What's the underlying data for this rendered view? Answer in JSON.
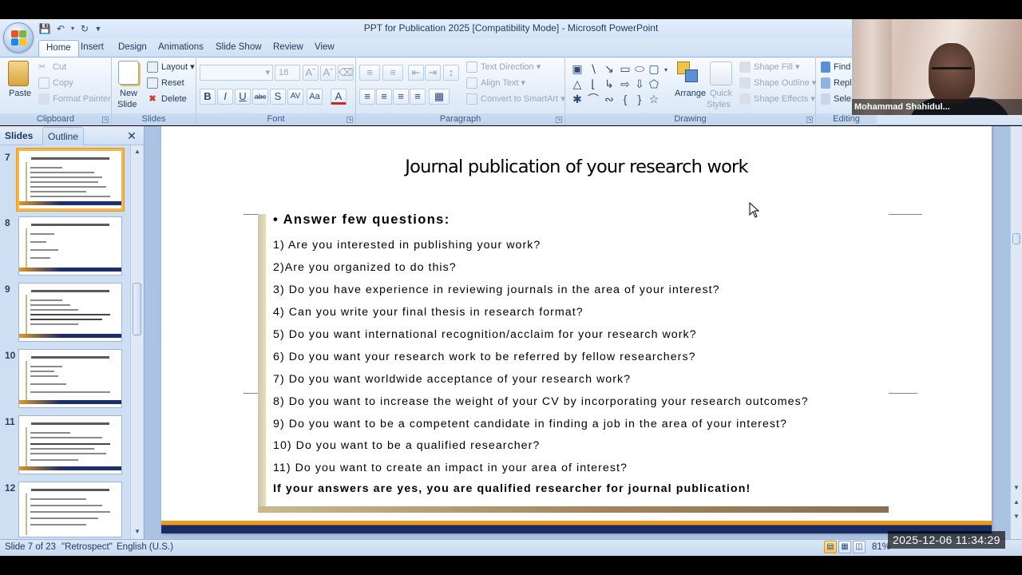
{
  "window": {
    "title": "PPT for Publication 2025 [Compatibility Mode] - Microsoft PowerPoint"
  },
  "ribbon_tabs": [
    "Home",
    "Insert",
    "Design",
    "Animations",
    "Slide Show",
    "Review",
    "View"
  ],
  "active_tab": "Home",
  "ribbon": {
    "clipboard": {
      "label": "Clipboard",
      "paste": "Paste",
      "cut": "Cut",
      "copy": "Copy",
      "format_painter": "Format Painter"
    },
    "slides": {
      "label": "Slides",
      "new_slide_1": "New",
      "new_slide_2": "Slide",
      "layout": "Layout",
      "reset": "Reset",
      "delete": "Delete"
    },
    "font": {
      "label": "Font",
      "font_size": "18",
      "buttons": [
        "B",
        "I",
        "U",
        "abc",
        "S",
        "AV",
        "Aa",
        "A"
      ]
    },
    "paragraph": {
      "label": "Paragraph",
      "text_direction": "Text Direction",
      "align_text": "Align Text",
      "convert_smartart": "Convert to SmartArt"
    },
    "drawing": {
      "label": "Drawing",
      "arrange": "Arrange",
      "quick_styles_1": "Quick",
      "quick_styles_2": "Styles",
      "shape_fill": "Shape Fill",
      "shape_outline": "Shape Outline",
      "shape_effects": "Shape Effects"
    },
    "editing": {
      "label": "Editing",
      "find": "Find",
      "replace": "Repl",
      "select": "Sele"
    }
  },
  "webcam": {
    "name": "Mohammad Shahidul..."
  },
  "left_pane": {
    "tabs": [
      "Slides",
      "Outline"
    ],
    "thumbnails": [
      {
        "number": "7",
        "selected": true
      },
      {
        "number": "8",
        "selected": false
      },
      {
        "number": "9",
        "selected": false
      },
      {
        "number": "10",
        "selected": false
      },
      {
        "number": "11",
        "selected": false
      },
      {
        "number": "12",
        "selected": false
      }
    ]
  },
  "slide": {
    "title": "Journal publication of your research work",
    "bullet_heading": "Answer few questions",
    "questions": [
      "1) Are you interested in publishing your work?",
      "2)Are you organized to do this?",
      "3) Do you have experience in reviewing journals in the area of your interest?",
      "4) Can you write your final thesis in research format?",
      "5) Do you want international recognition/acclaim for your research work?",
      "6) Do you want your research work to be referred by fellow researchers?",
      "7) Do you want worldwide acceptance of your research work?",
      "8) Do you want to increase the weight of your CV by incorporating your research outcomes?",
      "9) Do you want to be a competent candidate in finding a job in the area of your interest?",
      "10) Do you want to be a qualified researcher?",
      "11) Do you want to create an impact in your area of interest?"
    ],
    "conclusion": "If your answers are yes, you are qualified researcher for journal publication!"
  },
  "status_bar": {
    "slide_position": "Slide 7 of 23",
    "theme": "\"Retrospect\"",
    "language": "English (U.S.)",
    "zoom": "81%"
  },
  "overlay_timestamp": "2025-12-06  11:34:29",
  "colors": {
    "ribbon_bg": "#dce8f7",
    "selected_thumb": "#f5b54a",
    "slide_footer_orange": "#e79a1c",
    "slide_footer_navy": "#1a2a64"
  }
}
